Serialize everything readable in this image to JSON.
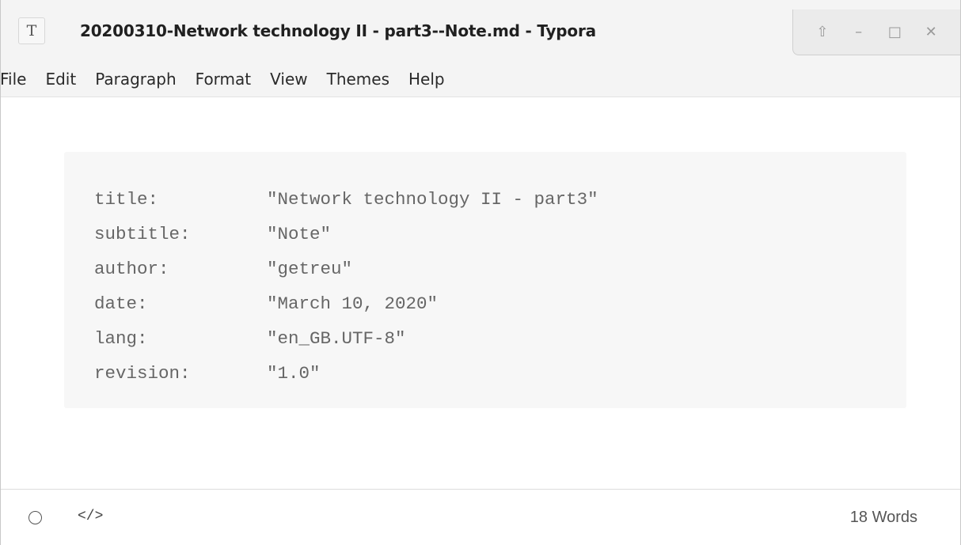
{
  "window": {
    "title": "20200310-Network technology II - part3--Note.md - Typora",
    "app_icon_glyph": "T",
    "controls": [
      {
        "name": "up-arrow-icon",
        "glyph": "⇧"
      },
      {
        "name": "minimize-icon",
        "glyph": "–"
      },
      {
        "name": "maximize-icon",
        "glyph": "□"
      },
      {
        "name": "close-icon",
        "glyph": "✕"
      }
    ]
  },
  "menu": {
    "file": "File",
    "edit": "Edit",
    "paragraph": "Paragraph",
    "format": "Format",
    "view": "View",
    "themes": "Themes",
    "help": "Help"
  },
  "front_matter": {
    "lines": [
      {
        "key": "title:",
        "value": "\"Network technology II - part3\""
      },
      {
        "key": "subtitle:",
        "value": "\"Note\""
      },
      {
        "key": "author:",
        "value": "\"getreu\""
      },
      {
        "key": "date:",
        "value": "\"March 10, 2020\""
      },
      {
        "key": "lang:",
        "value": "\"en_GB.UTF-8\""
      },
      {
        "key": "revision:",
        "value": "\"1.0\""
      }
    ]
  },
  "status": {
    "source_toggle": "</>",
    "word_count": "18 Words"
  },
  "colors": {
    "code_background": "#f7f7f7",
    "code_text": "#666666",
    "chrome_background": "#f4f4f4"
  }
}
